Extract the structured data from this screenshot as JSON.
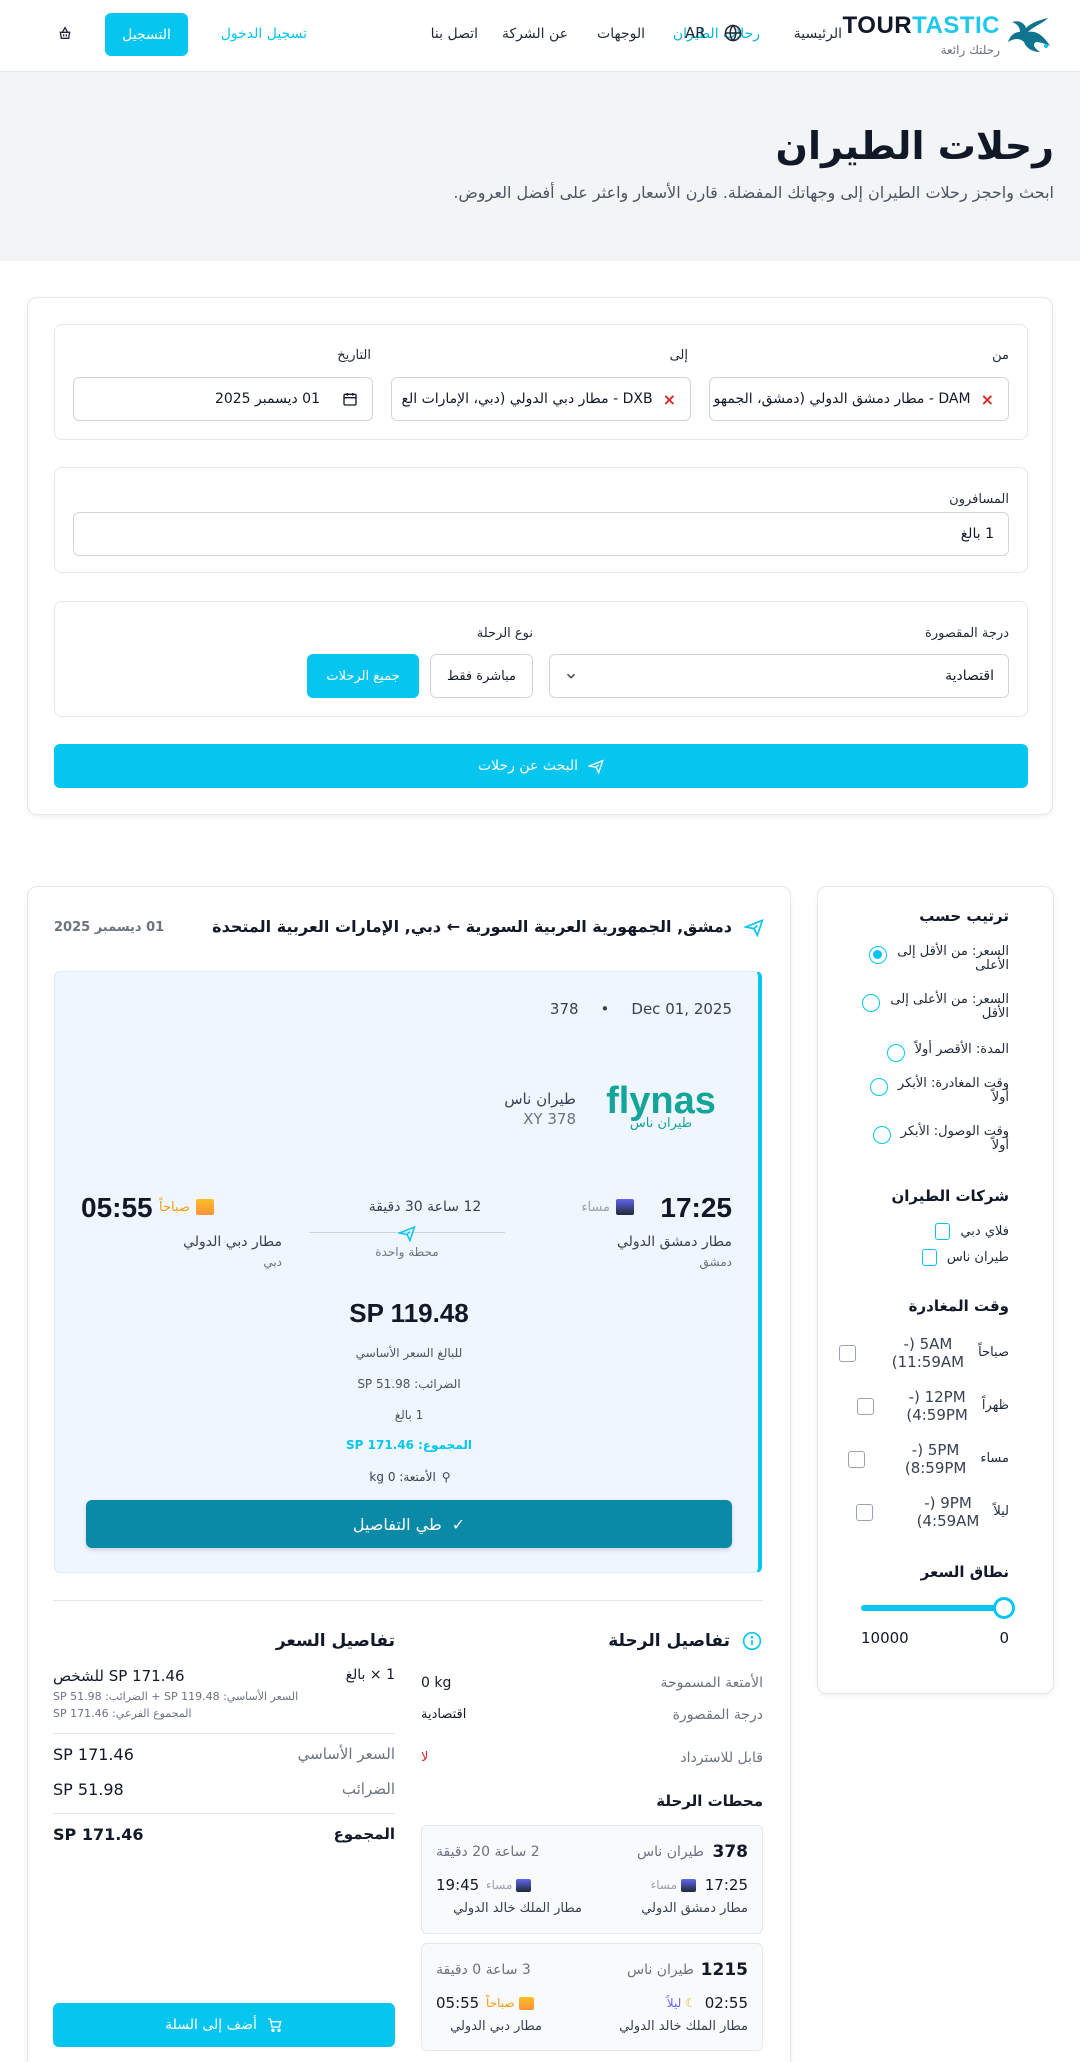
{
  "header": {
    "logo_part1": "TOUR",
    "logo_part2": "TASTIC",
    "tagline": "رحلتك رائعة",
    "nav": {
      "home": "الرئيسية",
      "flights": "رحلات الطيران",
      "destinations": "الوجهات",
      "about": "عن الشركة",
      "contact": "اتصل بنا"
    },
    "lang": "AR",
    "login": "تسجيل الدخول",
    "register": "التسجيل"
  },
  "hero": {
    "title": "رحلات الطيران",
    "subtitle": "ابحث واحجز رحلات الطيران إلى وجهاتك المفضلة. قارن الأسعار واعثر على أفضل العروض."
  },
  "search": {
    "from_label": "من",
    "from_value": "DAM - مطار دمشق الدولي (دمشق، الجمهو",
    "to_label": "إلى",
    "to_value": "DXB - مطار دبي الدولي (دبي، الإمارات الع",
    "date_label": "التاريخ",
    "date_value": "01 ديسمبر 2025",
    "passengers_label": "المسافرون",
    "passengers_value": "1 بالغ",
    "cabin_label": "درجة المقصورة",
    "cabin_value": "اقتصادية",
    "trip_type_label": "نوع الرحلة",
    "trip_direct": "مباشرة فقط",
    "trip_all": "جميع الرحلات",
    "search_button": "البحث عن رحلات"
  },
  "sidebar": {
    "sort_title": "ترتيب حسب",
    "sort_options": [
      {
        "line1": "السعر: من الأقل إلى",
        "line2": "الأعلى",
        "selected": true
      },
      {
        "line1": "السعر: من الأعلى إلى",
        "line2": "الأقل",
        "selected": false
      },
      {
        "line1": "المدة: الأقصر أولاً",
        "line2": "",
        "selected": false
      },
      {
        "line1": "وقت المغادرة: الأبكر",
        "line2": "أولاً",
        "selected": false
      },
      {
        "line1": "وقت الوصول: الأبكر",
        "line2": "أولاً",
        "selected": false
      }
    ],
    "airlines_title": "شركات الطيران",
    "airlines": [
      "فلاي دبي",
      "طيران ناس"
    ],
    "departure_title": "وقت المغادرة",
    "departure_options": [
      {
        "name": "صباحاً",
        "line1": "5AM (-",
        "line2": "11:59AM)"
      },
      {
        "name": "ظهراً",
        "line1": "12PM (-",
        "line2": "4:59PM)"
      },
      {
        "name": "مساء",
        "line1": "5PM (-",
        "line2": "8:59PM)"
      },
      {
        "name": "ليلاً",
        "line1": "9PM (-",
        "line2": "4:59AM)"
      }
    ],
    "price_title": "نطاق السعر",
    "price_min": "0",
    "price_max": "10000",
    "price_level": 0
  },
  "results": {
    "route_title": "دمشق, الجمهورية العربية السورية ← دبي, الإمارات العربية المتحدة",
    "route_date": "01 ديسمبر 2025",
    "flight": {
      "date": "Dec 01, 2025",
      "number": "378",
      "logo_text": "flynas",
      "logo_sub": "طيران ناس",
      "airline": "طيران ناس",
      "code": "XY 378",
      "dep_time": "17:25",
      "dep_period": "مساء",
      "dep_airport": "مطار دمشق الدولي",
      "dep_city": "دمشق",
      "duration": "12 ساعة 30 دقيقة",
      "stops": "محطة واحدة",
      "arr_time": "05:55",
      "arr_period": "صباحاً",
      "arr_airport": "مطار دبي الدولي",
      "arr_city": "دبي",
      "price": "SP 119.48",
      "base_note": "للبالغ السعر الأساسي",
      "taxes_note": "الضرائب: SP 51.98",
      "adults_note": "1 بالغ",
      "total_note": "المجموع: SP 171.46",
      "baggage_note": "الأمتعة: 0 kg",
      "toggle_label": "طي التفاصيل"
    }
  },
  "trip_details": {
    "title": "تفاصيل الرحلة",
    "baggage_label": "الأمتعة المسموحة",
    "baggage_value": "0 kg",
    "cabin_label": "درجة المقصورة",
    "cabin_value": "اقتصادية",
    "refund_label": "قابل للاسترداد",
    "refund_value": "لا",
    "stops_title": "محطات الرحلة",
    "segments": [
      {
        "number": "378",
        "airline": "طيران ناس",
        "duration": "2 ساعة 20 دقيقة",
        "dep_time": "17:25",
        "dep_period": "مساء",
        "dep_airport": "مطار دمشق الدولي",
        "arr_time": "19:45",
        "arr_period": "مساء",
        "arr_airport": "مطار الملك خالد الدولي"
      },
      {
        "number": "1215",
        "airline": "طيران ناس",
        "duration": "3 ساعة 0 دقيقة",
        "dep_time": "02:55",
        "dep_period": "ليلاً",
        "dep_airport": "مطار الملك خالد الدولي",
        "arr_time": "05:55",
        "arr_period": "صباحاً",
        "arr_airport": "مطار دبي الدولي"
      }
    ]
  },
  "price_details": {
    "title": "تفاصيل السعر",
    "pax_line": "1 × بالغ",
    "per_person": "SP 171.46 للشخص",
    "breakdown1": "السعر الأساسي: SP 119.48 + الضرائب: SP 51.98",
    "breakdown2": "المجموع الفرعي: SP 171.46",
    "base_label": "السعر الأساسي",
    "base_value": "SP 171.46",
    "taxes_label": "الضرائب",
    "taxes_value": "SP 51.98",
    "total_label": "المجموع",
    "total_value": "SP 171.46",
    "add_to_cart": "أضف إلى السلة"
  },
  "colors": {
    "accent": "#06c6ef",
    "accent_dark": "#0b8aa8",
    "flynas": "#14a59a",
    "danger": "#dc2626"
  }
}
